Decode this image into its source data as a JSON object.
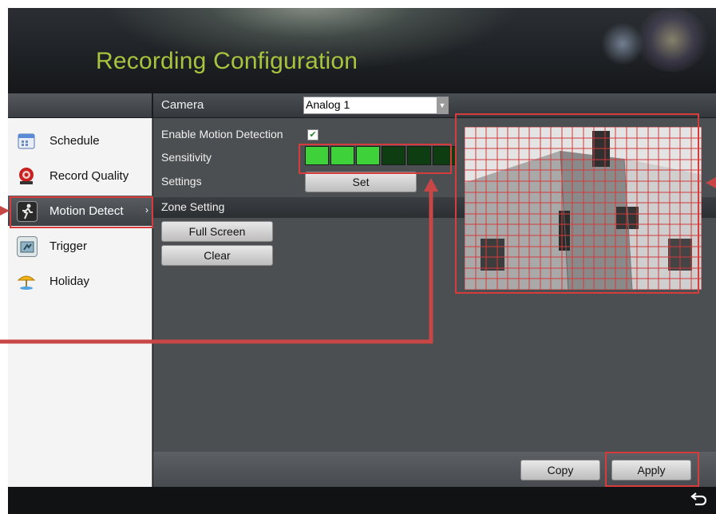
{
  "header": {
    "title": "Recording Configuration"
  },
  "camera": {
    "label": "Camera",
    "value": "Analog 1"
  },
  "sidebar": {
    "items": [
      {
        "label": "Schedule",
        "icon": "calendar-icon",
        "active": false
      },
      {
        "label": "Record Quality",
        "icon": "record-quality-icon",
        "active": false
      },
      {
        "label": "Motion Detect",
        "icon": "motion-detect-icon",
        "active": true
      },
      {
        "label": "Trigger",
        "icon": "trigger-icon",
        "active": false
      },
      {
        "label": "Holiday",
        "icon": "holiday-umbrella-icon",
        "active": false
      }
    ],
    "active_chevron": "›"
  },
  "motion": {
    "enable_label": "Enable Motion Detection",
    "enable_checked": true,
    "sensitivity_label": "Sensitivity",
    "sensitivity_level": 3,
    "sensitivity_max": 6,
    "settings_label": "Settings",
    "set_button": "Set"
  },
  "zone": {
    "header": "Zone Setting",
    "full_screen_button": "Full Screen",
    "clear_button": "Clear",
    "grid_cols": 22,
    "grid_rows": 15
  },
  "footer": {
    "copy_button": "Copy",
    "apply_button": "Apply"
  },
  "colors": {
    "title": "#a6c43e",
    "sensitivity_on": "#3fd13a",
    "sensitivity_off": "#0f3d12",
    "grid_line": "#d23a3a",
    "highlight": "#d63c3c"
  }
}
